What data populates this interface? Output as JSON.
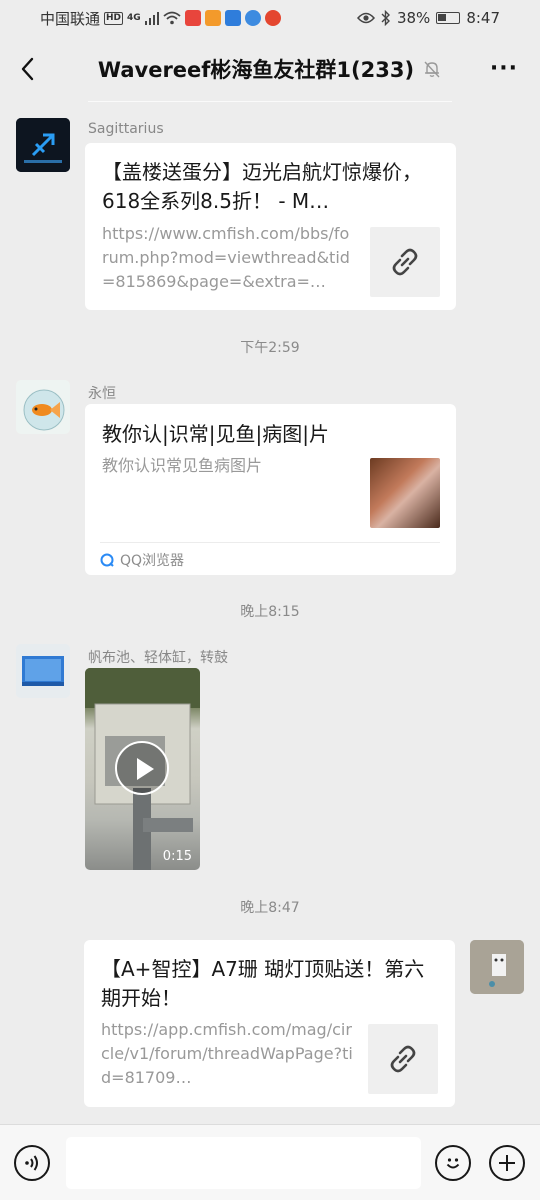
{
  "status_bar": {
    "carrier": "中国联通",
    "hd_badge": "HD",
    "network": "4G",
    "battery": "38%",
    "time": "8:47"
  },
  "header": {
    "title": "Wavereef彬海鱼友社群1(233)",
    "more_label": "···"
  },
  "messages": [
    {
      "sender": "Sagittarius",
      "card_title": "【盖楼送蛋分】迈光启航灯惊爆价，618全系列8.5折！ - M…",
      "card_desc": "https://www.cmfish.com/bbs/forum.php?mod=viewthread&tid=815869&page=&extra=…"
    },
    {
      "timestamp": "下午2:59"
    },
    {
      "sender": "永恒",
      "card_title": "教你认|识常|见鱼|病图|片",
      "card_desc": "教你认识常见鱼病图片",
      "source_label": "QQ浏览器"
    },
    {
      "timestamp": "晚上8:15"
    },
    {
      "sender": "帆布池、轻体缸，转鼓",
      "video_duration": "0:15"
    },
    {
      "timestamp": "晚上8:47"
    },
    {
      "card_title": "【A+智控】A7珊 瑚灯顶贴送！第六期开始！",
      "card_desc": "https://app.cmfish.com/mag/circle/v1/forum/threadWapPage?tid=81709…"
    }
  ],
  "icons": {
    "back": "chevron-left-icon",
    "mute": "bell-off-icon",
    "link": "link-icon",
    "voice": "voice-icon",
    "emoji": "emoji-icon",
    "plus": "plus-icon",
    "play": "play-icon",
    "browser": "qq-browser-icon"
  },
  "colors": {
    "background": "#ededed",
    "card": "#ffffff",
    "meta_text": "#888888"
  }
}
